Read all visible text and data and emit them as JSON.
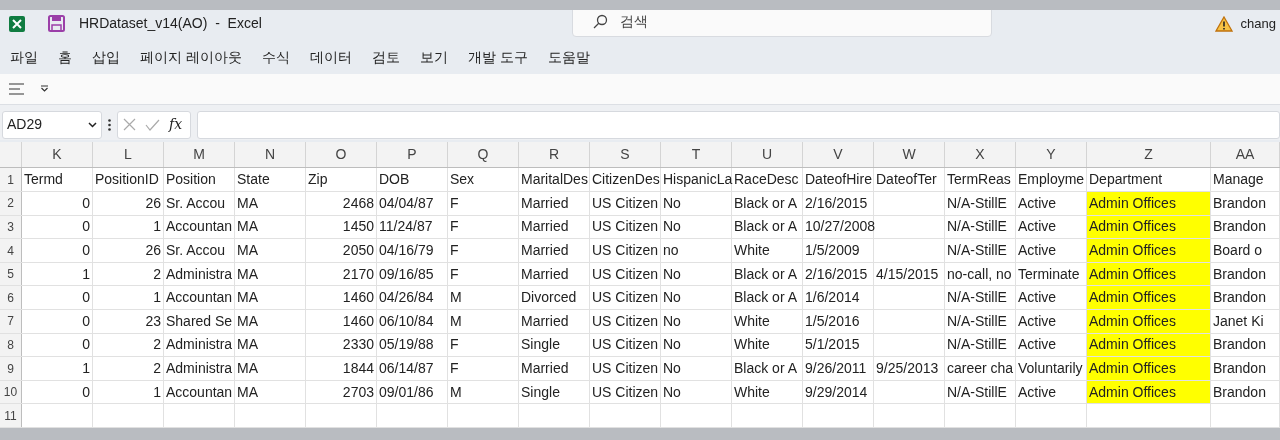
{
  "title_bar": {
    "title": "HRDataset_v14(AO)  -  Excel",
    "search_placeholder": "검색",
    "notice": "chang"
  },
  "menu": [
    "파일",
    "홈",
    "삽입",
    "페이지 레이아웃",
    "수식",
    "데이터",
    "검토",
    "보기",
    "개발 도구",
    "도움말"
  ],
  "formula_bar": {
    "name_box": "AD29",
    "fx": "fx"
  },
  "columns": [
    {
      "letter": "K",
      "kind": "number",
      "highlighted": false
    },
    {
      "letter": "L",
      "kind": "number",
      "highlighted": false
    },
    {
      "letter": "M",
      "kind": "text",
      "highlighted": false
    },
    {
      "letter": "N",
      "kind": "text",
      "highlighted": false
    },
    {
      "letter": "O",
      "kind": "number",
      "highlighted": false
    },
    {
      "letter": "P",
      "kind": "text",
      "highlighted": false
    },
    {
      "letter": "Q",
      "kind": "text",
      "highlighted": false
    },
    {
      "letter": "R",
      "kind": "text",
      "highlighted": false
    },
    {
      "letter": "S",
      "kind": "text",
      "highlighted": false
    },
    {
      "letter": "T",
      "kind": "text",
      "highlighted": false
    },
    {
      "letter": "U",
      "kind": "text",
      "highlighted": false
    },
    {
      "letter": "V",
      "kind": "text",
      "highlighted": false
    },
    {
      "letter": "W",
      "kind": "text",
      "highlighted": false
    },
    {
      "letter": "X",
      "kind": "text",
      "highlighted": false
    },
    {
      "letter": "Y",
      "kind": "text",
      "highlighted": false
    },
    {
      "letter": "Z",
      "kind": "wide",
      "highlighted": true
    },
    {
      "letter": "AA",
      "kind": "text",
      "highlighted": false
    }
  ],
  "rows": [
    {
      "number": "1",
      "cells": [
        "Termd",
        "PositionID",
        "Position",
        "State",
        "Zip",
        "DOB",
        "Sex",
        "MaritalDes",
        "CitizenDes",
        "HispanicLa",
        "RaceDesc",
        "DateofHire",
        "DateofTer",
        "TermReas",
        "Employme",
        "Department",
        "Manage"
      ]
    },
    {
      "number": "2",
      "cells": [
        "0",
        "26",
        "Sr. Accou",
        "MA",
        "2468",
        "04/04/87",
        "F",
        "Married",
        "US Citizen",
        "No",
        "Black or A",
        "2/16/2015",
        "",
        "N/A-StillE",
        "Active",
        "Admin Offices",
        "Brandon"
      ]
    },
    {
      "number": "3",
      "cells": [
        "0",
        "1",
        "Accountan",
        "MA",
        "1450",
        "11/24/87",
        "F",
        "Married",
        "US Citizen",
        "No",
        "Black or A",
        "10/27/2008",
        "",
        "N/A-StillE",
        "Active",
        "Admin Offices",
        "Brandon"
      ]
    },
    {
      "number": "4",
      "cells": [
        "0",
        "26",
        "Sr. Accou",
        "MA",
        "2050",
        "04/16/79",
        "F",
        "Married",
        "US Citizen",
        "no",
        "White",
        "1/5/2009",
        "",
        "N/A-StillE",
        "Active",
        "Admin Offices",
        "Board o"
      ]
    },
    {
      "number": "5",
      "cells": [
        "1",
        "2",
        "Administra",
        "MA",
        "2170",
        "09/16/85",
        "F",
        "Married",
        "US Citizen",
        "No",
        "Black or A",
        "2/16/2015",
        "4/15/2015",
        "no-call, no",
        "Terminate",
        "Admin Offices",
        "Brandon"
      ]
    },
    {
      "number": "6",
      "cells": [
        "0",
        "1",
        "Accountan",
        "MA",
        "1460",
        "04/26/84",
        "M",
        "Divorced",
        "US Citizen",
        "No",
        "Black or A",
        "1/6/2014",
        "",
        "N/A-StillE",
        "Active",
        "Admin Offices",
        "Brandon"
      ]
    },
    {
      "number": "7",
      "cells": [
        "0",
        "23",
        "Shared Se",
        "MA",
        "1460",
        "06/10/84",
        "M",
        "Married",
        "US Citizen",
        "No",
        "White",
        "1/5/2016",
        "",
        "N/A-StillE",
        "Active",
        "Admin Offices",
        "Janet Ki"
      ]
    },
    {
      "number": "8",
      "cells": [
        "0",
        "2",
        "Administra",
        "MA",
        "2330",
        "05/19/88",
        "F",
        "Single",
        "US Citizen",
        "No",
        "White",
        "5/1/2015",
        "",
        "N/A-StillE",
        "Active",
        "Admin Offices",
        "Brandon"
      ]
    },
    {
      "number": "9",
      "cells": [
        "1",
        "2",
        "Administra",
        "MA",
        "1844",
        "06/14/87",
        "F",
        "Married",
        "US Citizen",
        "No",
        "Black or A",
        "9/26/2011",
        "9/25/2013",
        "career cha",
        "Voluntarily",
        "Admin Offices",
        "Brandon"
      ]
    },
    {
      "number": "10",
      "cells": [
        "0",
        "1",
        "Accountan",
        "MA",
        "2703",
        "09/01/86",
        "M",
        "Single",
        "US Citizen",
        "No",
        "White",
        "9/29/2014",
        "",
        "N/A-StillE",
        "Active",
        "Admin Offices",
        "Brandon"
      ]
    },
    {
      "number": "11",
      "cells": [
        "",
        "",
        "",
        "",
        "",
        "",
        "",
        "",
        "",
        "",
        "",
        "",
        "",
        "",
        "",
        "",
        ""
      ]
    }
  ]
}
